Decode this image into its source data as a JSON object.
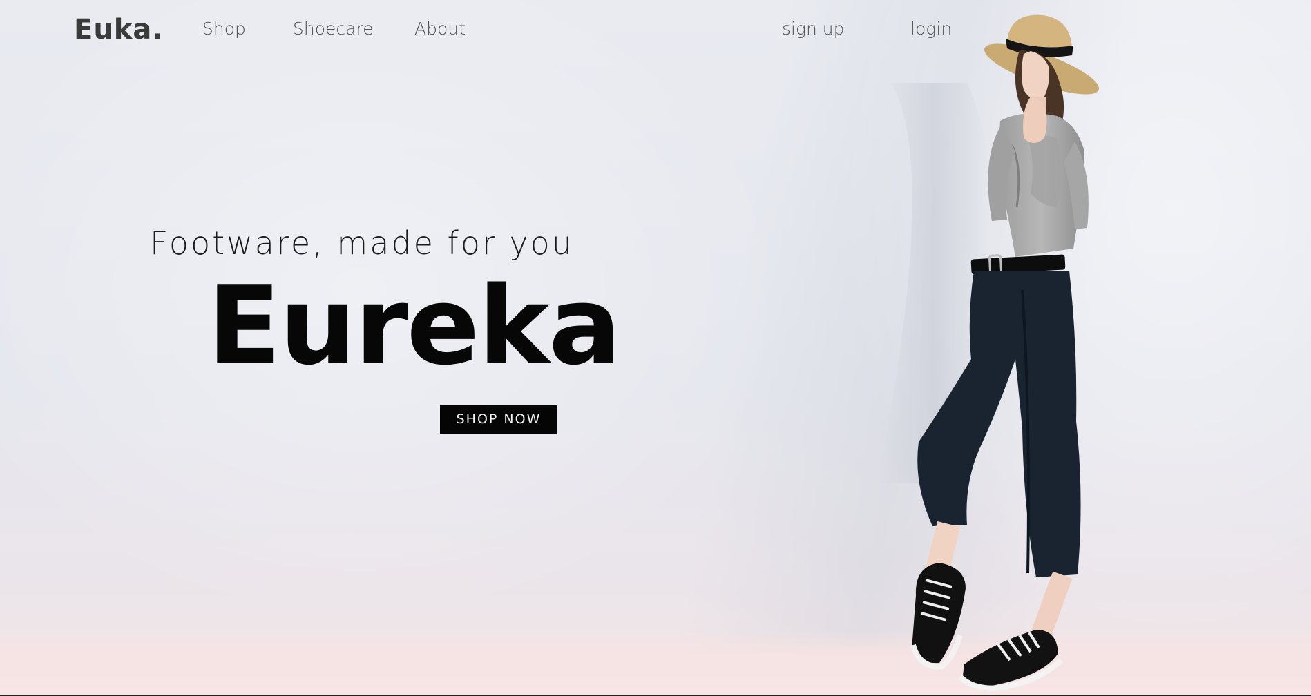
{
  "nav": {
    "logo": "Euka.",
    "links": [
      "Shop",
      "Shoecare",
      "About"
    ],
    "signup": "sign up",
    "login": "login"
  },
  "hero": {
    "tagline": "Footware, made for you",
    "title": "Eureka",
    "cta": "SHOP NOW"
  },
  "colors": {
    "background": "#e8eaf0",
    "accent": "#050505",
    "cta_text": "#f2f2f2"
  },
  "image": {
    "alt": "Model wearing straw hat, grey blouse, black cropped trousers and black canvas sneakers"
  }
}
